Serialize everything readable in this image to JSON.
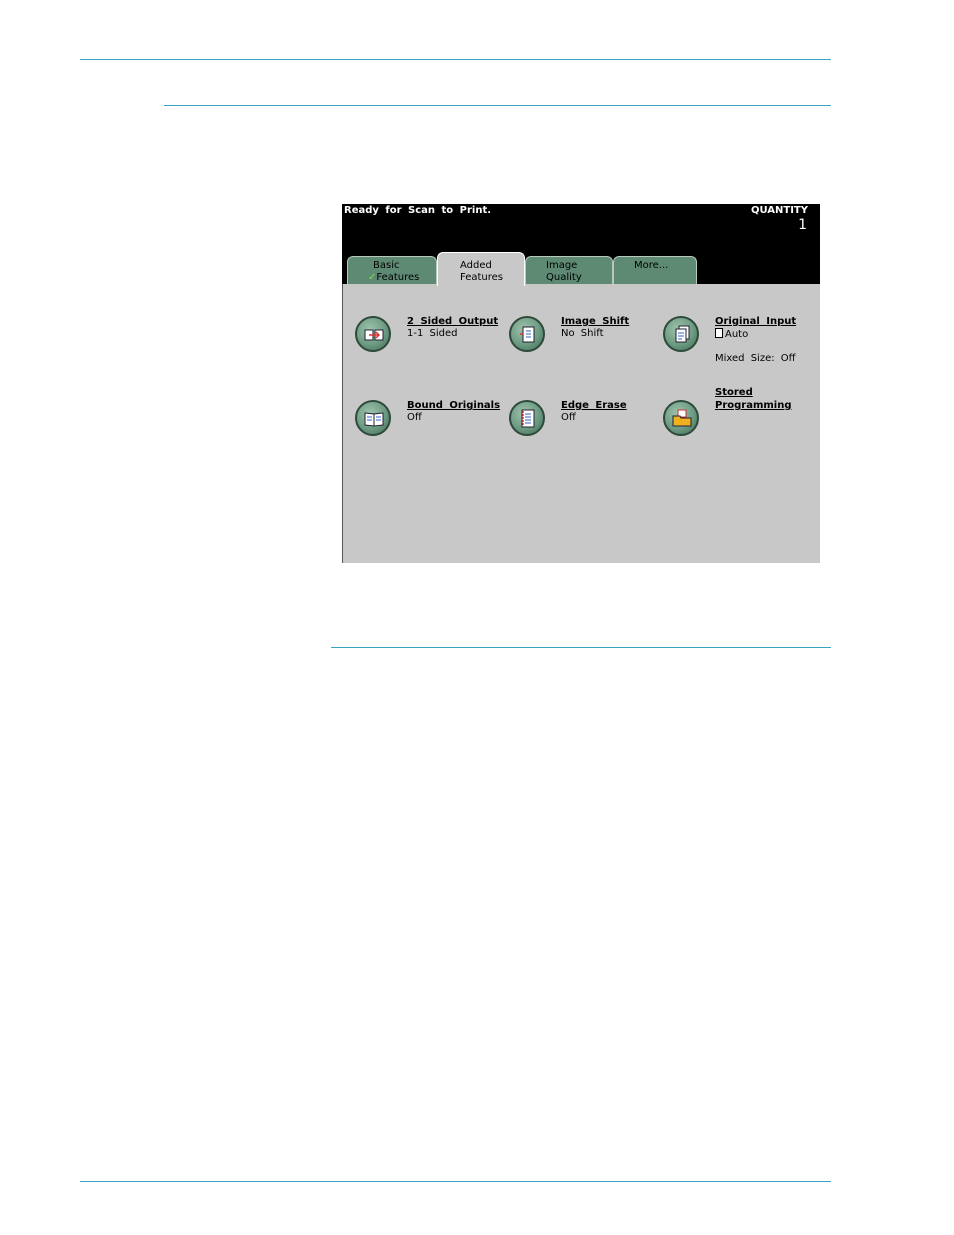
{
  "screen": {
    "status_text": "Ready for Scan to Print.",
    "quantity_label": "QUANTITY",
    "quantity_value": "1"
  },
  "tabs": [
    {
      "line1": "Basic",
      "line2": "Features",
      "checked": true
    },
    {
      "line1": "Added",
      "line2": "Features",
      "active": true
    },
    {
      "line1": "Image",
      "line2": "Quality"
    },
    {
      "line1": "",
      "line2": "More..."
    }
  ],
  "features": {
    "two_sided_output": {
      "title": "2 Sided Output",
      "value": "1-1 Sided",
      "icon": "two-sided-icon"
    },
    "image_shift": {
      "title": "Image Shift",
      "value": "No Shift",
      "icon": "image-shift-icon"
    },
    "original_input": {
      "title": "Original Input",
      "value": "Auto",
      "extra": "Mixed Size: Off",
      "icon": "original-input-icon"
    },
    "bound_originals": {
      "title": "Bound Originals",
      "value": "Off",
      "icon": "book-icon"
    },
    "edge_erase": {
      "title": "Edge Erase",
      "value": "Off",
      "icon": "edge-erase-icon"
    },
    "stored_programming": {
      "title": "Stored",
      "title2": "Programming",
      "icon": "folder-icon"
    }
  },
  "colors": {
    "accent_rule": "#3aa2c2",
    "tab_green": "#5e8a74",
    "panel_gray": "#c8c8c8"
  }
}
